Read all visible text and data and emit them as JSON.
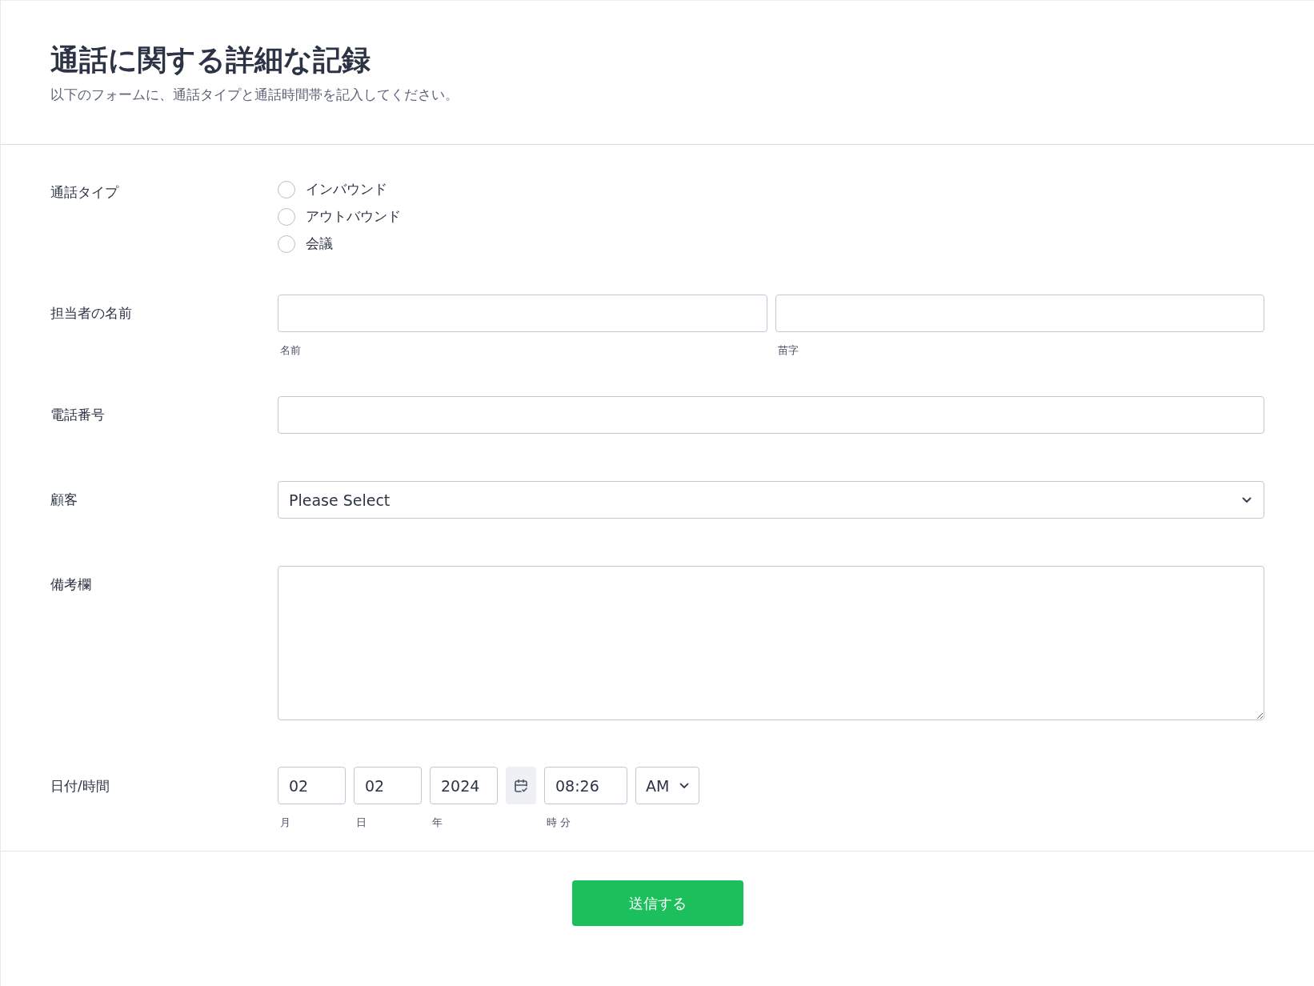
{
  "header": {
    "title": "通話に関する詳細な記録",
    "description": "以下のフォームに、通話タイプと通話時間帯を記入してください。"
  },
  "fields": [
    {
      "kind": "radio",
      "label": "通話タイプ",
      "options": [
        {
          "label": "インバウンド",
          "selected": false
        },
        {
          "label": "アウトバウンド",
          "selected": false
        },
        {
          "label": "会議",
          "selected": false
        }
      ]
    },
    {
      "kind": "name",
      "label": "担当者の名前",
      "inputs": [
        {
          "sublabel": "名前"
        },
        {
          "sublabel": "苗字"
        }
      ]
    },
    {
      "kind": "text",
      "label": "電話番号"
    },
    {
      "kind": "select",
      "label": "顧客",
      "value": "Please Select"
    },
    {
      "kind": "textarea",
      "label": "備考欄"
    },
    {
      "kind": "datetime",
      "label": "日付/時間",
      "parts": [
        {
          "value": "02",
          "sublabel": "月"
        },
        {
          "value": "02",
          "sublabel": "日"
        },
        {
          "value": "2024",
          "sublabel": "年"
        }
      ],
      "time": {
        "value": "08:26",
        "sublabel": "時 分"
      },
      "ampm": "AM"
    }
  ],
  "submit": "送信する"
}
